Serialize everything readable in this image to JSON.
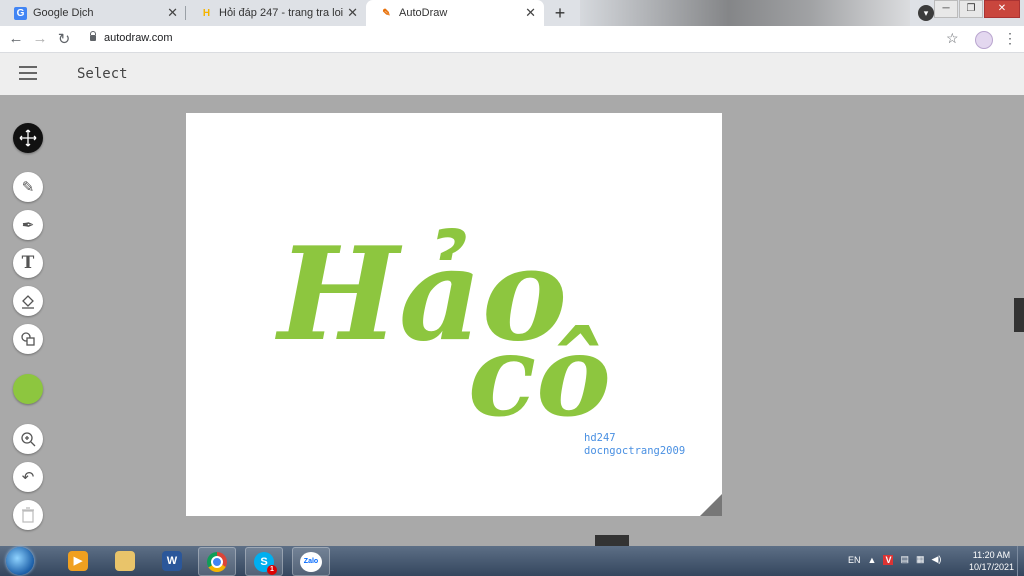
{
  "browser": {
    "tabs": [
      {
        "title": "Google Dịch",
        "favicon": "google-translate-icon",
        "active": false
      },
      {
        "title": "Hỏi đáp 247 - trang tra loi",
        "favicon": "hoidap247-icon",
        "active": false
      },
      {
        "title": "AutoDraw",
        "favicon": "autodraw-icon",
        "active": true
      }
    ],
    "url": "autodraw.com"
  },
  "app": {
    "mode_title": "Select",
    "tools": [
      {
        "name": "select-tool",
        "icon": "move-arrows-icon"
      },
      {
        "name": "autodraw-tool",
        "icon": "magic-pen-icon"
      },
      {
        "name": "draw-tool",
        "icon": "pen-icon"
      },
      {
        "name": "type-tool",
        "icon": "text-T-icon"
      },
      {
        "name": "fill-tool",
        "icon": "paint-bucket-icon"
      },
      {
        "name": "shape-tool",
        "icon": "shapes-icon"
      },
      {
        "name": "color-picker",
        "icon": "color-swatch"
      },
      {
        "name": "zoom-tool",
        "icon": "zoom-in-icon"
      },
      {
        "name": "undo-tool",
        "icon": "undo-icon"
      },
      {
        "name": "delete-tool",
        "icon": "trash-icon"
      }
    ],
    "selected_color": "#8dc63f",
    "canvas": {
      "lettering_line1": "Hảo",
      "lettering_line2": "cô",
      "credit_line1": "hd247",
      "credit_line2": "docngoctrang2009",
      "credit_color": "#4a90e2"
    }
  },
  "taskbar": {
    "language": "EN",
    "time": "11:20 AM",
    "date": "10/17/2021",
    "skype_badge": "1",
    "zalo_label": "Zalo"
  }
}
